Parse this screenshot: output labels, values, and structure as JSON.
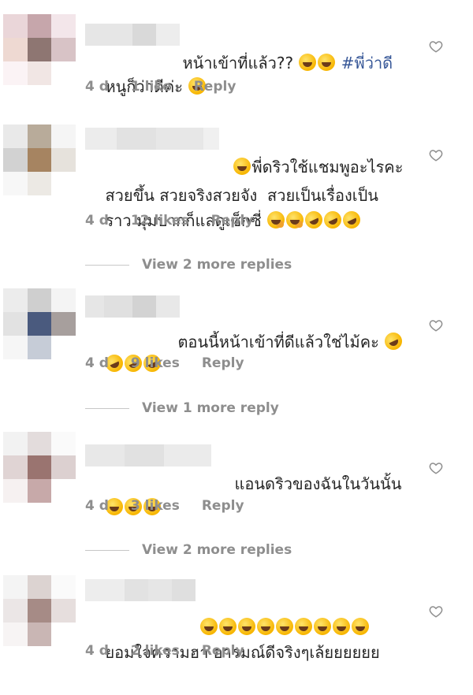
{
  "comments": [
    {
      "text_a": "หน้าเข้าที่แล้ว?? ",
      "emoji_a": [
        "grin",
        "grin"
      ],
      "hashtag": " #พี่ว่าดี",
      "text_b": "หนูก็ว่าดีค่ะ ",
      "emoji_b": [
        "grin-squint"
      ],
      "age": "4 d",
      "likes": "1 like",
      "reply": "Reply"
    },
    {
      "text_a": "พี่ดริวใช้แชมพูอะไรคะ",
      "text_b": "สวยขึ้น สวยจริงสวยจัง  สวยเป็นเรื่องเป็น",
      "text_c": "ราว มุมปากก็แลดูเซ็กซี่ ",
      "emoji_lead": [
        "grin-sweat"
      ],
      "emoji_c": [
        "hand-over-mouth",
        "hand-over-mouth",
        "rolling-laugh",
        "rolling-laugh",
        "rolling-laugh"
      ],
      "age": "4 d",
      "likes": "12 likes",
      "reply": "Reply",
      "view_replies": "View 2 more replies"
    },
    {
      "text_a": "ตอนนี้หน้าเข้าที่ดีแล้วใช่ไม้คะ ",
      "emoji_a": [
        "rolling-laugh"
      ],
      "emoji_b": [
        "rolling-laugh",
        "rolling-laugh",
        "rolling-laugh"
      ],
      "age": "4 d",
      "likes": "9 likes",
      "reply": "Reply",
      "view_replies": "View 1 more reply"
    },
    {
      "text_a": "แอนดริวของฉันในวันนั้น",
      "emoji_b": [
        "joy",
        "joy",
        "joy"
      ],
      "age": "4 d",
      "likes": "3 likes",
      "reply": "Reply",
      "view_replies": "View 2 more replies"
    },
    {
      "emoji_a": [
        "joy",
        "joy",
        "joy",
        "joy",
        "joy",
        "joy",
        "joy",
        "joy",
        "joy"
      ],
      "text_b": "ยอมใจความฮา อารมณ์ดีจริงๆเล้ยยยยยย",
      "age": "4 d",
      "likes": "2 likes",
      "reply": "Reply"
    }
  ],
  "icons": {
    "like": "heart-outline-icon"
  },
  "colors": {
    "meta": "#8e8e8e",
    "text": "#262626",
    "hashtag": "#385898"
  }
}
